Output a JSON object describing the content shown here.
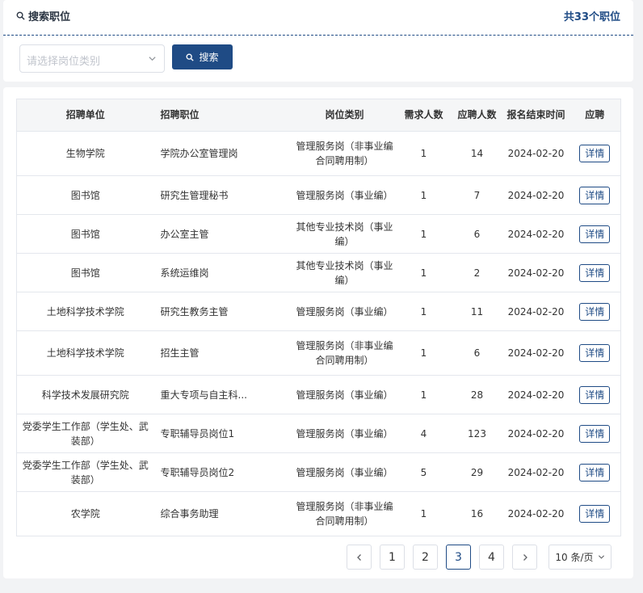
{
  "search": {
    "title": "搜索职位",
    "total": "共33个职位",
    "select_placeholder": "请选择岗位类别",
    "button_label": "搜索"
  },
  "table": {
    "headers": [
      "招聘单位",
      "招聘职位",
      "岗位类别",
      "需求人数",
      "应聘人数",
      "报名结束时间",
      "应聘"
    ],
    "rows": [
      {
        "unit": "生物学院",
        "position": "学院办公室管理岗",
        "category": "管理服务岗（非事业编合同聘用制）",
        "demand": "1",
        "applicants": "14",
        "deadline": "2024-02-20",
        "action": "详情"
      },
      {
        "unit": "图书馆",
        "position": "研究生管理秘书",
        "category": "管理服务岗（事业编）",
        "demand": "1",
        "applicants": "7",
        "deadline": "2024-02-20",
        "action": "详情"
      },
      {
        "unit": "图书馆",
        "position": "办公室主管",
        "category": "其他专业技术岗（事业编）",
        "demand": "1",
        "applicants": "6",
        "deadline": "2024-02-20",
        "action": "详情"
      },
      {
        "unit": "图书馆",
        "position": "系统运维岗",
        "category": "其他专业技术岗（事业编）",
        "demand": "1",
        "applicants": "2",
        "deadline": "2024-02-20",
        "action": "详情"
      },
      {
        "unit": "土地科学技术学院",
        "position": "研究生教务主管",
        "category": "管理服务岗（事业编）",
        "demand": "1",
        "applicants": "11",
        "deadline": "2024-02-20",
        "action": "详情"
      },
      {
        "unit": "土地科学技术学院",
        "position": "招生主管",
        "category": "管理服务岗（非事业编合同聘用制）",
        "demand": "1",
        "applicants": "6",
        "deadline": "2024-02-20",
        "action": "详情"
      },
      {
        "unit": "科学技术发展研究院",
        "position": "重大专项与自主科...",
        "category": "管理服务岗（事业编）",
        "demand": "1",
        "applicants": "28",
        "deadline": "2024-02-20",
        "action": "详情"
      },
      {
        "unit": "党委学生工作部（学生处、武装部）",
        "position": "专职辅导员岗位1",
        "category": "管理服务岗（事业编）",
        "demand": "4",
        "applicants": "123",
        "deadline": "2024-02-20",
        "action": "详情"
      },
      {
        "unit": "党委学生工作部（学生处、武装部）",
        "position": "专职辅导员岗位2",
        "category": "管理服务岗（事业编）",
        "demand": "5",
        "applicants": "29",
        "deadline": "2024-02-20",
        "action": "详情"
      },
      {
        "unit": "农学院",
        "position": "综合事务助理",
        "category": "管理服务岗（非事业编合同聘用制）",
        "demand": "1",
        "applicants": "16",
        "deadline": "2024-02-20",
        "action": "详情"
      }
    ]
  },
  "pagination": {
    "pages": [
      "1",
      "2",
      "3",
      "4"
    ],
    "current": "3",
    "page_size": "10 条/页"
  },
  "colors": {
    "primary": "#1f4b85",
    "border": "#e4e7ed",
    "header_bg": "#f5f6f7",
    "page_bg": "#f2f3f5"
  }
}
